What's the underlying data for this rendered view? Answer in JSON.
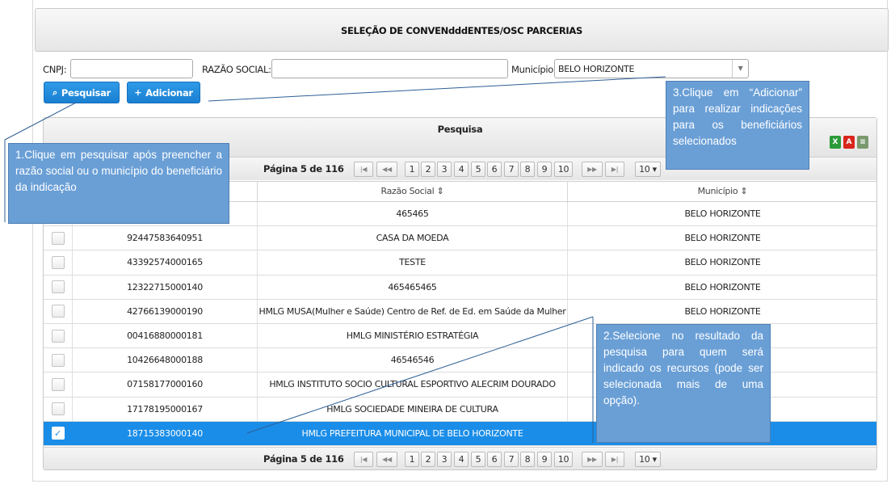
{
  "page_title": "SELEÇÃO DE CONVENdddENTES/OSC PARCERIAS",
  "filters": {
    "cnpj_label": "CNPJ:",
    "cnpj_value": "",
    "razao_label": "RAZÃO SOCIAL:",
    "razao_value": "",
    "municipio_label": "Município:",
    "municipio_value": "BELO HORIZONTE"
  },
  "buttons": {
    "search": "Pesquisar",
    "add": "Adicionar"
  },
  "grid": {
    "caption": "Pesquisa",
    "export_icons": [
      "excel-icon",
      "pdf-icon",
      "csv-icon"
    ],
    "pager": {
      "info": "Página 5 de 116",
      "first": "⏮",
      "prev": "«",
      "pages": [
        "1",
        "2",
        "3",
        "4",
        "5",
        "6",
        "7",
        "8",
        "9",
        "10"
      ],
      "next": "»",
      "last": "⏭",
      "page_size": "10 ▾"
    },
    "columns": [
      "Razão Social ⇕",
      "Município ⇕"
    ],
    "rows": [
      {
        "cnpj": "",
        "razao": "465465",
        "municipio": "BELO HORIZONTE",
        "checked": false
      },
      {
        "cnpj": "92447583640951",
        "razao": "CASA DA MOEDA",
        "municipio": "BELO HORIZONTE",
        "checked": false
      },
      {
        "cnpj": "43392574000165",
        "razao": "TESTE",
        "municipio": "BELO HORIZONTE",
        "checked": false
      },
      {
        "cnpj": "12322715000140",
        "razao": "465465465",
        "municipio": "BELO HORIZONTE",
        "checked": false
      },
      {
        "cnpj": "42766139000190",
        "razao": "HMLG MUSA(Mulher e Saúde) Centro de Ref. de Ed. em Saúde da Mulher",
        "municipio": "BELO HORIZONTE",
        "checked": false
      },
      {
        "cnpj": "00416880000181",
        "razao": "HMLG MINISTÉRIO ESTRATÉGIA",
        "municipio": "",
        "checked": false
      },
      {
        "cnpj": "10426648000188",
        "razao": "46546546",
        "municipio": "",
        "checked": false
      },
      {
        "cnpj": "07158177000160",
        "razao": "HMLG INSTITUTO SOCIO CULTURAL ESPORTIVO ALECRIM DOURADO",
        "municipio": "",
        "checked": false
      },
      {
        "cnpj": "17178195000167",
        "razao": "HMLG SOCIEDADE MINEIRA DE CULTURA",
        "municipio": "",
        "checked": false
      },
      {
        "cnpj": "18715383000140",
        "razao": "HMLG PREFEITURA MUNICIPAL DE BELO HORIZONTE",
        "municipio": "",
        "checked": true
      }
    ]
  },
  "callouts": {
    "c1": "1.Clique em pesquisar após preencher a razão social ou o município do beneficiário da indicação",
    "c2": "2.Selecione no resultado da pesquisa para quem será indicado os recursos (pode ser selecionada mais de uma opção).",
    "c3": "3.Clique em “Adicionar” para realizar indicações para os beneficiários selecionados"
  },
  "colors": {
    "accent": "#1a8de8",
    "callout": "#6a9fd6"
  }
}
